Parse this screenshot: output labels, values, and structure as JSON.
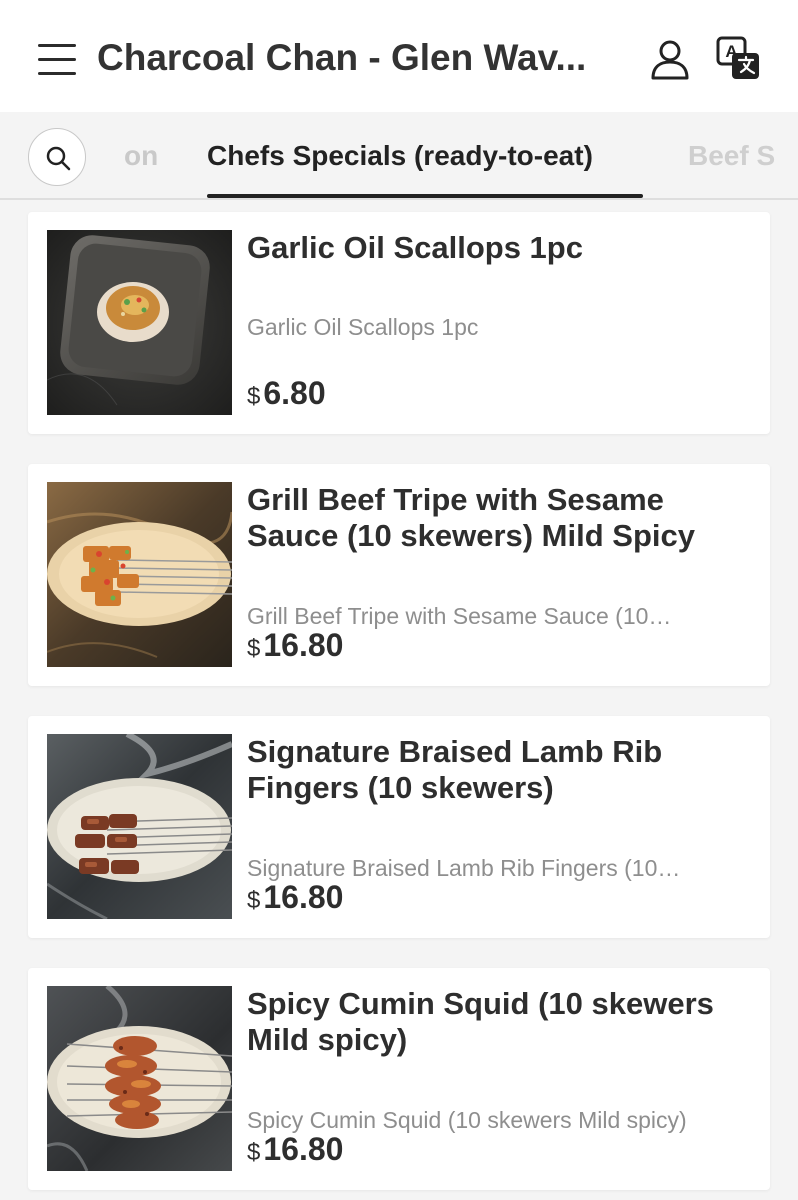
{
  "header": {
    "title": "Charcoal Chan - Glen Wav...",
    "menu_icon": "hamburger-menu-icon",
    "user_icon": "user-icon",
    "translate_icon": "translate-icon"
  },
  "tabs": {
    "prev_partial": "on",
    "active": "Chefs Specials (ready-to-eat)",
    "next_partial": "Beef S"
  },
  "currency_symbol": "$",
  "items": [
    {
      "name": "Garlic Oil Scallops 1pc",
      "description": "Garlic Oil Scallops 1pc",
      "price": "6.80"
    },
    {
      "name": "Grill Beef Tripe with Sesame Sauce (10 skewers) Mild Spicy",
      "description": "Grill Beef Tripe with Sesame Sauce (10…",
      "price": "16.80"
    },
    {
      "name": "Signature Braised Lamb Rib Fingers (10 skewers)",
      "description": "Signature Braised Lamb Rib Fingers (10…",
      "price": "16.80"
    },
    {
      "name": "Spicy Cumin Squid (10 skewers Mild spicy)",
      "description": "Spicy Cumin Squid (10 skewers Mild spicy)",
      "price": "16.80"
    }
  ],
  "colors": {
    "text_primary": "#2b2b2b",
    "text_secondary": "#8e8e8e",
    "tab_inactive": "#c9c9c9",
    "background": "#f4f4f4"
  }
}
